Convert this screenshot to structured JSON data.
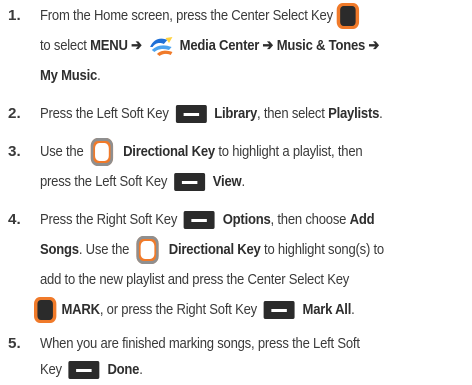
{
  "steps": [
    {
      "number": "1.",
      "lines": [
        {
          "segments": [
            "From the Home screen, press the Center Select Key"
          ]
        },
        {
          "segments": [
            "to select ",
            "MENU",
            " ➔ ",
            "Media Center",
            " ➔ ",
            "Music & Tones",
            " ➔"
          ]
        },
        {
          "segments": [
            "My Music",
            "."
          ]
        }
      ]
    },
    {
      "number": "2.",
      "lines": [
        {
          "segments": [
            "Press the Left Soft Key",
            "Library",
            ", then select ",
            "Playlists",
            "."
          ]
        }
      ]
    },
    {
      "number": "3.",
      "lines": [
        {
          "segments": [
            "Use the",
            "Directional Key",
            " to highlight a playlist, then"
          ]
        },
        {
          "segments": [
            "press the Left Soft Key",
            "View",
            "."
          ]
        }
      ]
    },
    {
      "number": "4.",
      "lines": [
        {
          "segments": [
            "Press the Right Soft Key",
            "Options",
            ", then choose ",
            "Add"
          ]
        },
        {
          "segments": [
            "Songs",
            ". Use the",
            "Directional Key",
            " to highlight song(s) to"
          ]
        },
        {
          "segments": [
            "add to the new playlist and press the Center Select Key"
          ]
        },
        {
          "segments": [
            "MARK",
            ", or press the Right Soft Key",
            "Mark All",
            "."
          ]
        }
      ]
    },
    {
      "number": "5.",
      "lines": [
        {
          "segments": [
            "When you are finished marking songs, press the Left Soft"
          ]
        },
        {
          "segments": [
            "Key",
            "Done",
            "."
          ]
        }
      ]
    }
  ],
  "icons": {
    "center_select_key": "center-select-key-icon",
    "left_soft_key": "soft-key-icon",
    "directional_key": "directional-key-icon",
    "media_center": "media-center-icon"
  },
  "colors": {
    "accent_orange": "#f07a2a",
    "key_dark": "#2b2b2b",
    "text": "#3a3a3a"
  }
}
